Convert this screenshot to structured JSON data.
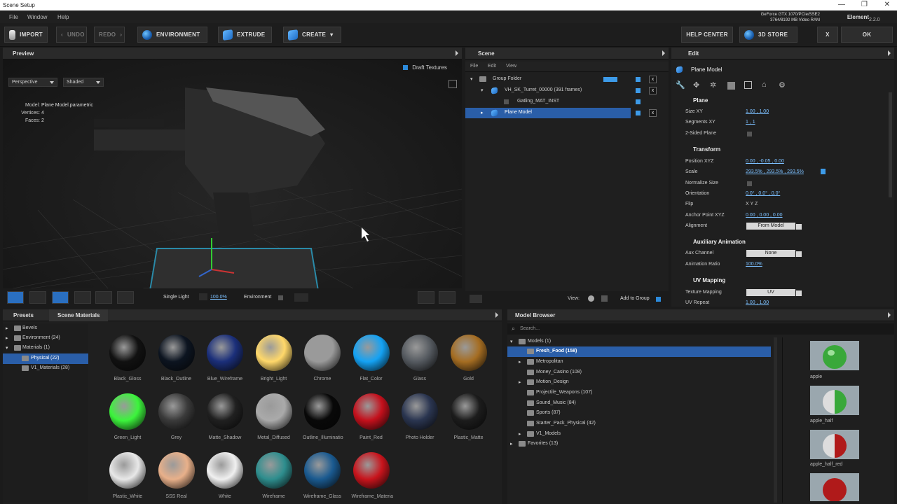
{
  "window": {
    "title": "Scene Setup",
    "min": "—",
    "max": "❐",
    "close": "✕"
  },
  "menu": [
    "File",
    "Window",
    "Help"
  ],
  "toolbar": {
    "import": "IMPORT",
    "undo": "UNDO",
    "redo": "REDO",
    "environment": "ENVIRONMENT",
    "extrude": "EXTRUDE",
    "create": "CREATE",
    "help": "HELP CENTER",
    "store": "3D STORE",
    "close": "X",
    "ok": "OK"
  },
  "gpu": {
    "line1": "GeForce GTX 1070/PCIe/SSE2",
    "line2": "3764/8192 MB Video RAM"
  },
  "app": {
    "name": "Element",
    "version": "2.2.0"
  },
  "preview": {
    "title": "Preview",
    "draft": "Draft Textures",
    "camera": "Perspective",
    "shading": "Shaded",
    "model_label": "Model:",
    "model": "Plane Model.parametric",
    "vertices_label": "Vertices:",
    "vertices": "4",
    "faces_label": "Faces:",
    "faces": "2",
    "light": "Single Light",
    "light_pct": "100.0%",
    "env": "Environment"
  },
  "scene": {
    "title": "Scene",
    "menu": [
      "File",
      "Edit",
      "View"
    ],
    "items": [
      {
        "label": "Group Folder"
      },
      {
        "label": "VH_SK_Turret_00000 (391 frames)"
      },
      {
        "label": "Gatling_MAT_INST"
      },
      {
        "label": "Plane Model"
      }
    ],
    "view": "View:",
    "add": "Add to Group"
  },
  "edit": {
    "title": "Edit",
    "object": "Plane Model",
    "plane": "Plane",
    "size_l": "Size XY",
    "size_v": "1.00 ,  1.00",
    "seg_l": "Segments XY",
    "seg_v": "1 ,  1",
    "two_l": "2-Sided Plane",
    "transform": "Transform",
    "pos_l": "Position XYZ",
    "pos_v": "0.00 ,  -0.05 ,  0.00",
    "scale_l": "Scale",
    "scale_v": "293.5% ,  293.5% ,  293.5%",
    "norm_l": "Normalize Size",
    "orient_l": "Orientation",
    "orient_v": "0.0° ,  0.0° ,  0.0°",
    "flip_l": "Flip",
    "flip_v": "X       Y       Z",
    "anchor_l": "Anchor Point XYZ",
    "anchor_v": "0.00 ,  0.00 ,  0.00",
    "align_l": "Alignment",
    "align_v": "From Model",
    "aux": "Auxiliary Animation",
    "auxch_l": "Aux Channel",
    "auxch_v": "None",
    "ratio_l": "Animation Ratio",
    "ratio_v": "100.0%",
    "uv": "UV Mapping",
    "tex_l": "Texture Mapping",
    "tex_v": "UV",
    "rep_l": "UV Repeat",
    "rep_v": "1.00 ,  1.00"
  },
  "presets": {
    "tab1": "Presets",
    "tab2": "Scene Materials",
    "tree": [
      "Bevels",
      "Environment (24)",
      "Materials (1)",
      "Physical (22)",
      "V1_Materials (28)"
    ],
    "materials": [
      {
        "name": "Black_Gloss",
        "c": "#111"
      },
      {
        "name": "Black_Outline",
        "c": "#0c1420"
      },
      {
        "name": "Blue_Wireframe",
        "c": "#1b2f7a"
      },
      {
        "name": "Bright_Light",
        "c": "#ffd86a"
      },
      {
        "name": "Chrome",
        "c": "#9a9a9a"
      },
      {
        "name": "Flat_Color",
        "c": "#14a2f4"
      },
      {
        "name": "Glass",
        "c": "#555a60"
      },
      {
        "name": "Gold",
        "c": "#a56d22"
      },
      {
        "name": "Green_Light",
        "c": "#3cf43c"
      },
      {
        "name": "Grey",
        "c": "#3a3a3a"
      },
      {
        "name": "Matte_Shadow",
        "c": "#202020"
      },
      {
        "name": "Metal_Diffused",
        "c": "#aaa"
      },
      {
        "name": "Outline_Illuminatio",
        "c": "#080808"
      },
      {
        "name": "Paint_Red",
        "c": "#c4101c"
      },
      {
        "name": "Photo Holder",
        "c": "#2a3550"
      },
      {
        "name": "Plastic_Matte",
        "c": "#1c1c1c"
      },
      {
        "name": "Plastic_White",
        "c": "#e8e8e8"
      },
      {
        "name": "SSS Real",
        "c": "#e8b08a"
      },
      {
        "name": "White",
        "c": "#f0f0f0"
      },
      {
        "name": "Wireframe",
        "c": "#2e8e8e"
      },
      {
        "name": "Wireframe_Glass",
        "c": "#1a5a90"
      },
      {
        "name": "Wireframe_Materia",
        "c": "#c8141c"
      }
    ]
  },
  "browser": {
    "title": "Model Browser",
    "search": "Search...",
    "tree": [
      "Models (1)",
      "Fresh_Food (158)",
      "Metropolitan",
      "Money_Casino (108)",
      "Motion_Design",
      "Projectile_Weapons (107)",
      "Sound_Music (84)",
      "Sports (87)",
      "Starter_Pack_Physical (42)",
      "V1_Models",
      "Favorites (13)"
    ],
    "thumbs": [
      "apple",
      "apple_half",
      "apple_half_red"
    ]
  }
}
